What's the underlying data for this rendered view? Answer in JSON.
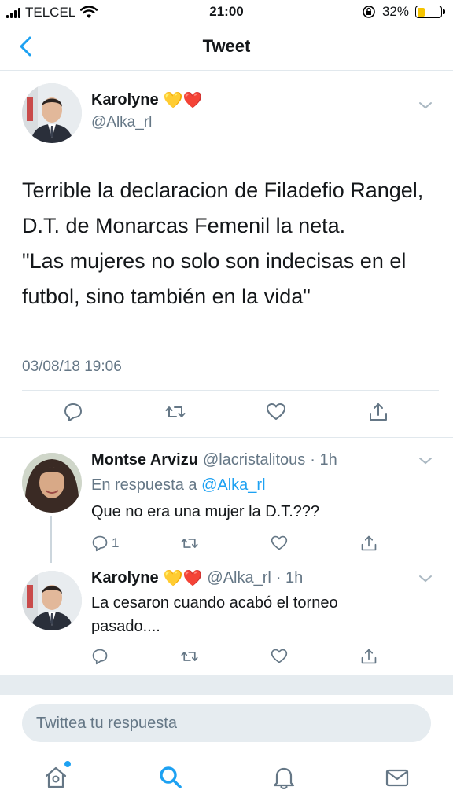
{
  "status_bar": {
    "carrier": "TELCEL",
    "time": "21:00",
    "battery_percent": "32%",
    "battery_level": 0.32
  },
  "nav": {
    "title": "Tweet",
    "back_icon": "chevron-left-icon"
  },
  "main_tweet": {
    "name": "Karolyne",
    "emojis": "💛❤️",
    "handle": "@Alka_rl",
    "text_lines": [
      "Terrible la declaracion de Filadefio Rangel, D.T. de Monarcas Femenil la neta.",
      "\"Las mujeres no solo son indecisas en el futbol, sino también en la vida\""
    ],
    "timestamp": "03/08/18 19:06"
  },
  "replies": [
    {
      "name": "Montse Arvizu",
      "handle": "@lacristalitous",
      "time": "· 1h",
      "in_reply_prefix": "En respuesta a",
      "in_reply_handle": "@Alka_rl",
      "text": "Que no era una mujer la D.T.???",
      "reply_count": "1"
    },
    {
      "name": "Karolyne",
      "emojis": "💛❤️",
      "handle": "@Alka_rl",
      "time": "· 1h",
      "text_lines": [
        "La cesaron cuando acabó el torneo",
        "pasado...."
      ]
    }
  ],
  "reply_input": {
    "placeholder": "Twittea tu respuesta"
  },
  "colors": {
    "accent": "#1da1f2",
    "secondary_text": "#657786",
    "divider": "#e1e8ed"
  }
}
